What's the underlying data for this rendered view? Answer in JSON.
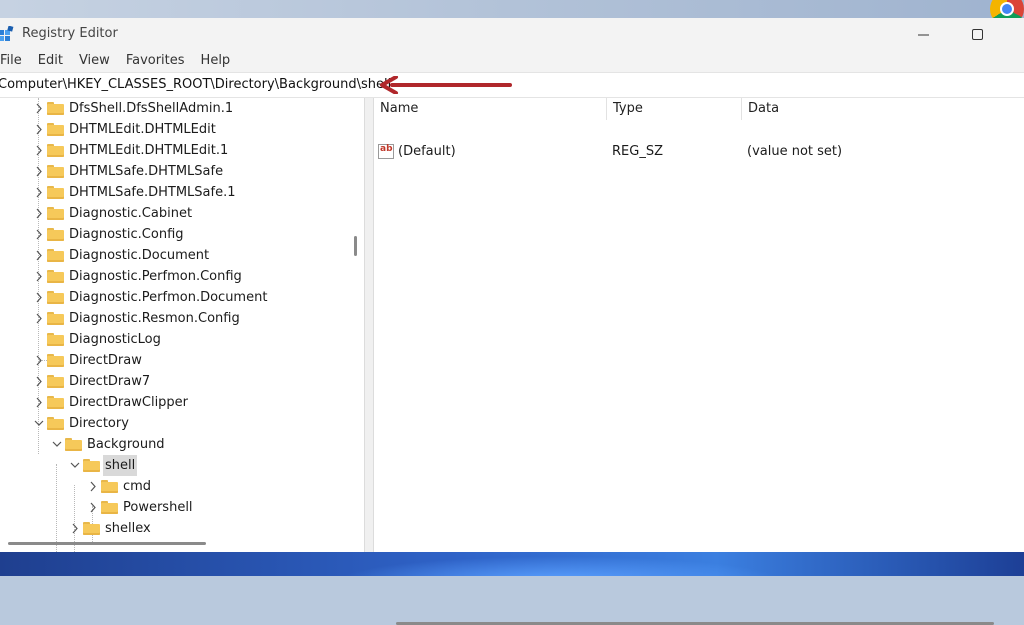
{
  "window": {
    "title": "Registry Editor"
  },
  "menu": [
    "File",
    "Edit",
    "View",
    "Favorites",
    "Help"
  ],
  "address": {
    "path": "Computer\\HKEY_CLASSES_ROOT\\Directory\\Background\\shell"
  },
  "tree": {
    "nodes": [
      {
        "label": "DfsShell.DfsShellAdmin.1",
        "depth": 0,
        "expander": "collapsed"
      },
      {
        "label": "DHTMLEdit.DHTMLEdit",
        "depth": 0,
        "expander": "collapsed"
      },
      {
        "label": "DHTMLEdit.DHTMLEdit.1",
        "depth": 0,
        "expander": "collapsed"
      },
      {
        "label": "DHTMLSafe.DHTMLSafe",
        "depth": 0,
        "expander": "collapsed"
      },
      {
        "label": "DHTMLSafe.DHTMLSafe.1",
        "depth": 0,
        "expander": "collapsed"
      },
      {
        "label": "Diagnostic.Cabinet",
        "depth": 0,
        "expander": "collapsed"
      },
      {
        "label": "Diagnostic.Config",
        "depth": 0,
        "expander": "collapsed"
      },
      {
        "label": "Diagnostic.Document",
        "depth": 0,
        "expander": "collapsed"
      },
      {
        "label": "Diagnostic.Perfmon.Config",
        "depth": 0,
        "expander": "collapsed"
      },
      {
        "label": "Diagnostic.Perfmon.Document",
        "depth": 0,
        "expander": "collapsed"
      },
      {
        "label": "Diagnostic.Resmon.Config",
        "depth": 0,
        "expander": "collapsed"
      },
      {
        "label": "DiagnosticLog",
        "depth": 0,
        "expander": "none"
      },
      {
        "label": "DirectDraw",
        "depth": 0,
        "expander": "collapsed"
      },
      {
        "label": "DirectDraw7",
        "depth": 0,
        "expander": "collapsed"
      },
      {
        "label": "DirectDrawClipper",
        "depth": 0,
        "expander": "collapsed"
      },
      {
        "label": "Directory",
        "depth": 0,
        "expander": "expanded"
      },
      {
        "label": "Background",
        "depth": 1,
        "expander": "expanded"
      },
      {
        "label": "shell",
        "depth": 2,
        "expander": "expanded",
        "selected": true
      },
      {
        "label": "cmd",
        "depth": 3,
        "expander": "collapsed"
      },
      {
        "label": "Powershell",
        "depth": 3,
        "expander": "collapsed"
      },
      {
        "label": "shellex",
        "depth": 2,
        "expander": "collapsed"
      }
    ]
  },
  "values": {
    "columns": [
      "Name",
      "Type",
      "Data"
    ],
    "rows": [
      {
        "name": "(Default)",
        "type": "REG_SZ",
        "data": "(value not set)",
        "icon": "string-value-icon"
      }
    ]
  },
  "colors": {
    "annotation_arrow": "#b0272b",
    "folder": "#f6c95a",
    "selection": "#d9d9d9"
  }
}
